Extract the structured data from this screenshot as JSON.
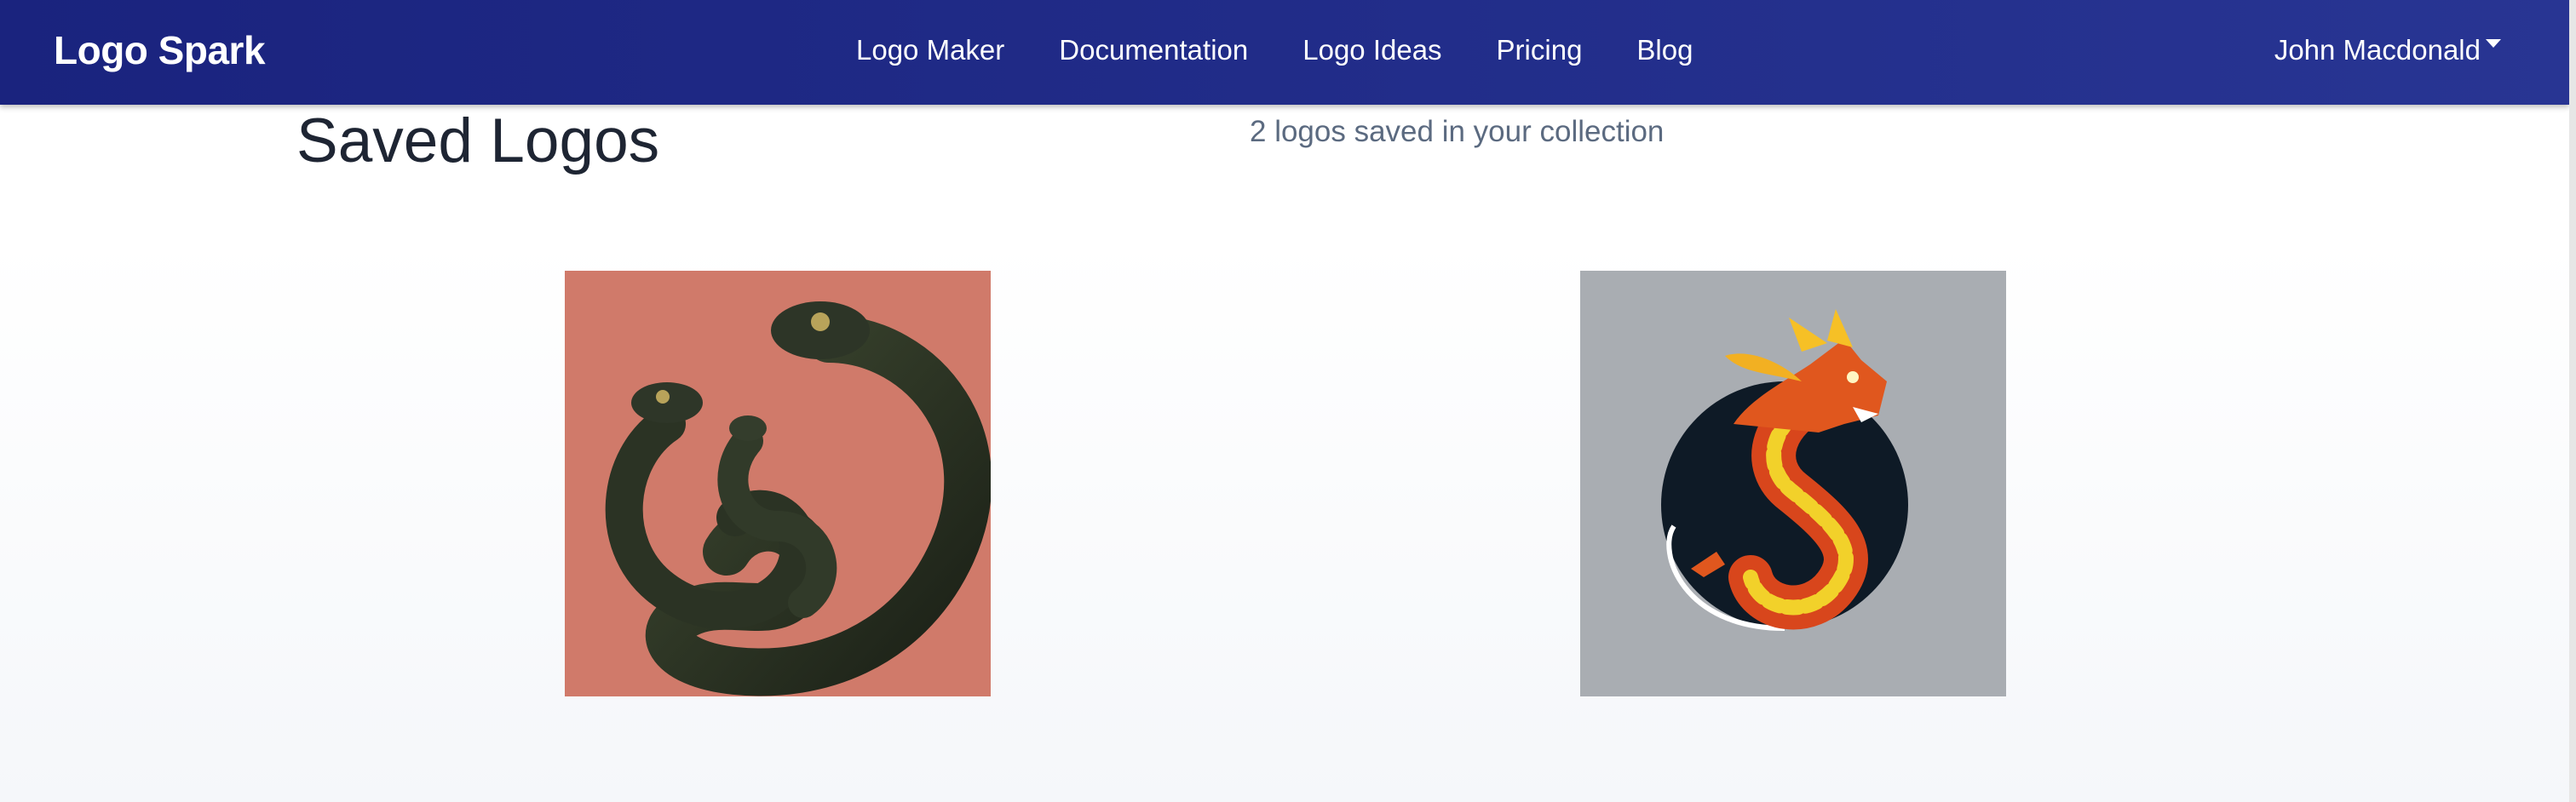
{
  "navbar": {
    "brand": "Logo Spark",
    "links": [
      "Logo Maker",
      "Documentation",
      "Logo Ideas",
      "Pricing",
      "Blog"
    ],
    "user_name": "John Macdonald"
  },
  "page": {
    "title": "Saved Logos",
    "subtitle": "2 logos saved in your collection"
  },
  "logos": [
    {
      "subject": "snakes",
      "background": "#d07a6a"
    },
    {
      "subject": "dragon",
      "background": "#a9adb2"
    }
  ],
  "colors": {
    "navbar_start": "#1a237e",
    "navbar_end": "#283593",
    "title": "#1e2533",
    "subtitle": "#5b6a80"
  }
}
